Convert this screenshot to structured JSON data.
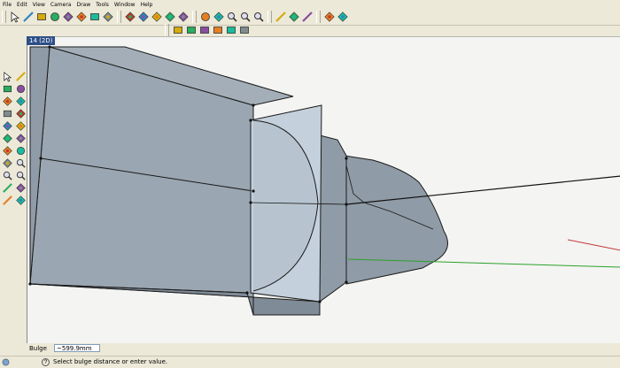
{
  "menu": [
    "File",
    "Edit",
    "View",
    "Camera",
    "Draw",
    "Tools",
    "Window",
    "Help"
  ],
  "toolbar_icons": [
    "select-arrow-icon",
    "pencil-icon",
    "rectangle-icon",
    "circle-icon",
    "arc-icon",
    "polygon-icon",
    "eraser-icon",
    "paint-bucket-icon",
    "push-pull-icon",
    "move-icon",
    "rotate-icon",
    "follow-me-icon",
    "offset-icon",
    "orbit-icon",
    "pan-icon",
    "zoom-icon",
    "zoom-window-icon",
    "zoom-extents-icon",
    "tape-measure-icon",
    "protractor-icon",
    "dimension-icon",
    "components-icon",
    "section-plane-icon"
  ],
  "view_icons": [
    "iso-view-icon",
    "top-view-icon",
    "front-view-icon",
    "right-view-icon",
    "back-view-icon",
    "left-view-icon"
  ],
  "scene_tab": "14 (2D)",
  "vcb": {
    "label": "Bulge",
    "value": "~599.9mm"
  },
  "status": {
    "help": "?",
    "message": "Select bulge distance or enter value."
  },
  "colors": {
    "model_face": "#8f9ba6",
    "model_face_dark": "#7f8b97",
    "section_face": "#c4d0dc",
    "viewport_bg": "#f4f4f2",
    "axis_red": "#c23a3a",
    "axis_green": "#2aa22a"
  }
}
